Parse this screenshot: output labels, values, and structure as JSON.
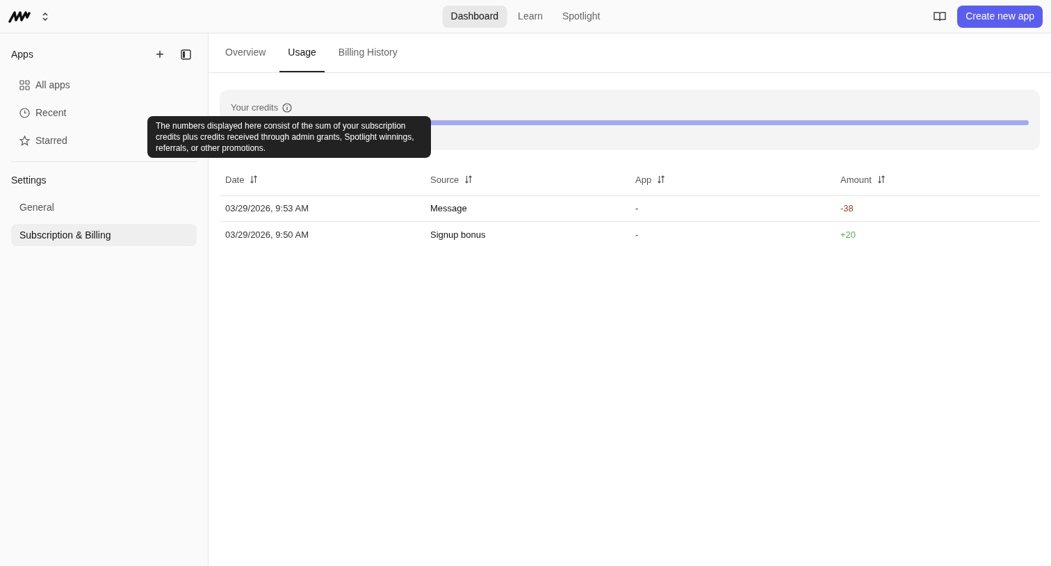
{
  "top_nav": {
    "tabs": [
      {
        "label": "Dashboard",
        "selected": true
      },
      {
        "label": "Learn",
        "selected": false
      },
      {
        "label": "Spotlight",
        "selected": false
      }
    ],
    "create_button": "Create new app"
  },
  "sidebar": {
    "apps_heading": "Apps",
    "items": [
      {
        "label": "All apps"
      },
      {
        "label": "Recent"
      },
      {
        "label": "Starred"
      }
    ],
    "settings_heading": "Settings",
    "settings_items": [
      {
        "label": "General",
        "selected": false
      },
      {
        "label": "Subscription & Billing",
        "selected": true
      }
    ]
  },
  "tabs": [
    {
      "label": "Overview",
      "selected": false
    },
    {
      "label": "Usage",
      "selected": true
    },
    {
      "label": "Billing History",
      "selected": false
    }
  ],
  "credits": {
    "label": "Your credits",
    "level": 1,
    "tooltip": "The numbers displayed here consist of the sum of your subscription credits plus credits received through admin grants, Spotlight winnings, referrals, or other promotions."
  },
  "table": {
    "columns": [
      "Date",
      "Source",
      "App",
      "Amount"
    ],
    "rows": [
      {
        "date": "03/29/2026, 9:53 AM",
        "source": "Message",
        "app": "-",
        "amount": "-38",
        "kind": "debit"
      },
      {
        "date": "03/29/2026, 9:50 AM",
        "source": "Signup bonus",
        "app": "-",
        "amount": "+20",
        "kind": "credit"
      }
    ]
  }
}
